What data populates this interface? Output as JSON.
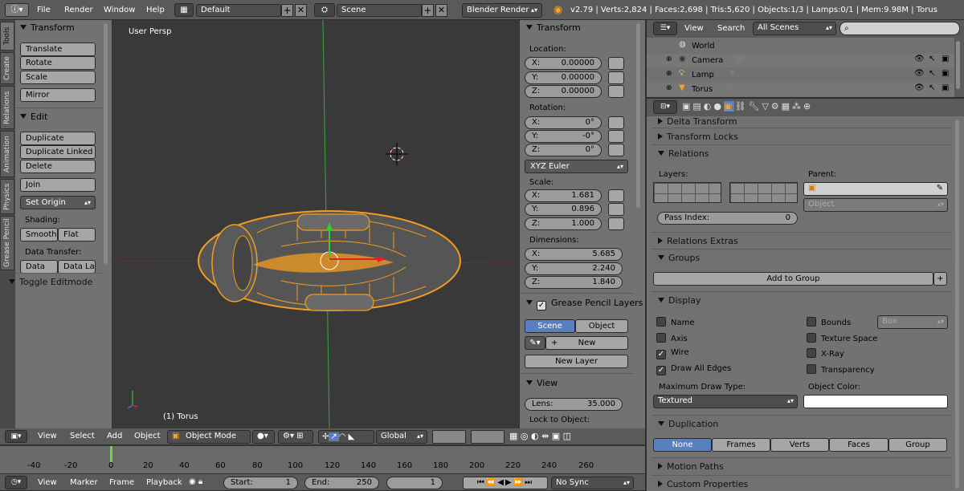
{
  "top_header": {
    "menus": [
      "File",
      "Render",
      "Window",
      "Help"
    ],
    "screen_layout": "Default",
    "scene": "Scene",
    "engine": "Blender Render",
    "stats": "v2.79 | Verts:2,824 | Faces:2,698 | Tris:5,620 | Objects:1/3 | Lamps:0/1 | Mem:9.98M | Torus"
  },
  "tool_tabs": [
    "Tools",
    "Create",
    "Relations",
    "Animation",
    "Physics",
    "Grease Pencil"
  ],
  "tool_shelf": {
    "transform_title": "Transform",
    "translate": "Translate",
    "rotate": "Rotate",
    "scale": "Scale",
    "mirror": "Mirror",
    "edit_title": "Edit",
    "duplicate": "Duplicate",
    "duplicate_linked": "Duplicate Linked",
    "delete": "Delete",
    "join": "Join",
    "set_origin": "Set Origin",
    "shading_label": "Shading:",
    "smooth": "Smooth",
    "flat": "Flat",
    "data_transfer_label": "Data Transfer:",
    "data": "Data",
    "data_la": "Data La",
    "toggle_editmode": "Toggle Editmode"
  },
  "viewport": {
    "view_label": "User Persp",
    "object_label": "(1) Torus"
  },
  "n_panel": {
    "transform_title": "Transform",
    "location_label": "Location:",
    "loc": [
      {
        "axis": "X:",
        "value": "0.00000"
      },
      {
        "axis": "Y:",
        "value": "0.00000"
      },
      {
        "axis": "Z:",
        "value": "0.00000"
      }
    ],
    "rotation_label": "Rotation:",
    "rot": [
      {
        "axis": "X:",
        "value": "0°"
      },
      {
        "axis": "Y:",
        "value": "-0°"
      },
      {
        "axis": "Z:",
        "value": "0°"
      }
    ],
    "rotation_mode": "XYZ Euler",
    "scale_label": "Scale:",
    "scale": [
      {
        "axis": "X:",
        "value": "1.681"
      },
      {
        "axis": "Y:",
        "value": "0.896"
      },
      {
        "axis": "Z:",
        "value": "1.000"
      }
    ],
    "dimensions_label": "Dimensions:",
    "dims": [
      {
        "axis": "X:",
        "value": "5.685"
      },
      {
        "axis": "Y:",
        "value": "2.240"
      },
      {
        "axis": "Z:",
        "value": "1.840"
      }
    ],
    "gp_title": "Grease Pencil Layers",
    "gp_scene": "Scene",
    "gp_object": "Object",
    "gp_new": "New",
    "gp_new_layer": "New Layer",
    "view_title": "View",
    "lens_label": "Lens:",
    "lens_value": "35.000",
    "lock_label": "Lock to Object:"
  },
  "viewport_header": {
    "view": "View",
    "select": "Select",
    "add": "Add",
    "object": "Object",
    "mode": "Object Mode",
    "orientation": "Global"
  },
  "timeline": {
    "ticks": [
      "-40",
      "-20",
      "0",
      "20",
      "40",
      "60",
      "80",
      "100",
      "120",
      "140",
      "160",
      "180",
      "200",
      "220",
      "240",
      "260"
    ],
    "view": "View",
    "marker": "Marker",
    "frame": "Frame",
    "playback": "Playback",
    "start_label": "Start:",
    "start_value": "1",
    "end_label": "End:",
    "end_value": "250",
    "current": "1",
    "sync": "No Sync"
  },
  "outliner": {
    "view": "View",
    "search": "Search",
    "filter": "All Scenes",
    "items": [
      "World",
      "Camera",
      "Lamp",
      "Torus"
    ]
  },
  "properties": {
    "delta_transform": "Delta Transform",
    "transform_locks": "Transform Locks",
    "relations": "Relations",
    "layers_label": "Layers:",
    "parent_label": "Parent:",
    "parent_type": "Object",
    "pass_index_label": "Pass Index:",
    "pass_index_value": "0",
    "relations_extras": "Relations Extras",
    "groups": "Groups",
    "add_to_group": "Add to Group",
    "display": "Display",
    "name": "Name",
    "axis": "Axis",
    "wire": "Wire",
    "draw_all_edges": "Draw All Edges",
    "bounds": "Bounds",
    "bounds_type": "Box",
    "texture_space": "Texture Space",
    "xray": "X-Ray",
    "transparency": "Transparency",
    "max_draw_label": "Maximum Draw Type:",
    "max_draw_value": "Textured",
    "object_color_label": "Object Color:",
    "duplication": "Duplication",
    "dup_none": "None",
    "dup_frames": "Frames",
    "dup_verts": "Verts",
    "dup_faces": "Faces",
    "dup_group": "Group",
    "motion_paths": "Motion Paths",
    "custom_properties": "Custom Properties"
  },
  "colors": {
    "selected_orange": "#f39c1f",
    "active_blue": "#5680c2",
    "viewport_bg": "#393939",
    "panel_bg": "#727272"
  }
}
